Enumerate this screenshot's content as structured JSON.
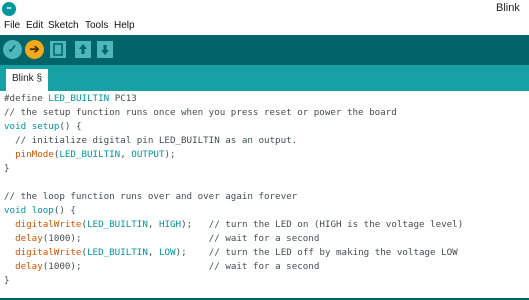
{
  "window": {
    "title": "Blink"
  },
  "menu": [
    "File",
    "Edit",
    "Sketch",
    "Tools",
    "Help"
  ],
  "toolbar": {
    "verify_icon": "check-icon",
    "upload_icon": "arrow-right-icon",
    "new_icon": "new-file-icon",
    "open_icon": "open-up-icon",
    "save_icon": "save-down-icon"
  },
  "tabs": [
    {
      "label": "Blink §"
    }
  ],
  "colors": {
    "toolbar": "#006468",
    "tabbar": "#17a1a5",
    "keyword": "#00979c",
    "function": "#d35400",
    "comment": "#434f54",
    "upload_button": "#f2a91a"
  },
  "code": {
    "define": {
      "directive": "#define",
      "name": "LED_BUILTIN",
      "value": "PC13"
    },
    "comment_setup": "// the setup function runs once when you press reset or power the board",
    "setup": {
      "type": "void",
      "name": "setup",
      "sig": "() {"
    },
    "comment_init": "  // initialize digital pin LED_BUILTIN as an output.",
    "pinmode": {
      "fn": "pinMode",
      "open": "(",
      "arg1": "LED_BUILTIN",
      "sep": ", ",
      "arg2": "OUTPUT",
      "close": ");"
    },
    "close_brace": "}",
    "comment_loop": "// the loop function runs over and over again forever",
    "loop": {
      "type": "void",
      "name": "loop",
      "sig": "() {"
    },
    "line1": {
      "fn": "digitalWrite",
      "open": "(",
      "arg1": "LED_BUILTIN",
      "sep": ", ",
      "arg2": "HIGH",
      "close": ");",
      "pad": "   ",
      "comment": "// turn the LED on (HIGH is the voltage level)"
    },
    "line2": {
      "fn": "delay",
      "args": "(1000);",
      "pad": "                       ",
      "comment": "// wait for a second"
    },
    "line3": {
      "fn": "digitalWrite",
      "open": "(",
      "arg1": "LED_BUILTIN",
      "sep": ", ",
      "arg2": "LOW",
      "close": ");",
      "pad": "    ",
      "comment": "// turn the LED off by making the voltage LOW"
    },
    "line4": {
      "fn": "delay",
      "args": "(1000);",
      "pad": "                       ",
      "comment": "// wait for a second"
    },
    "end_brace": "}"
  }
}
